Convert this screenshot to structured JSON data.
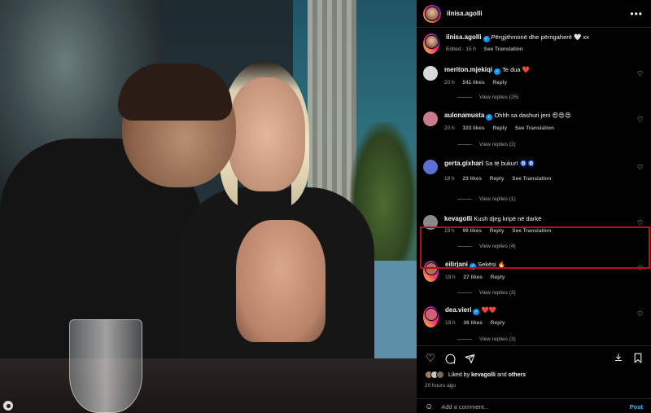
{
  "post": {
    "author": "ilnisa.agolli",
    "caption": "Përgjithmonë dhe përngaherë 🤍 xx",
    "caption_meta": {
      "edited": "Edited · 15 h",
      "see_translation": "See Translation"
    },
    "liked_by_prefix": "Liked by",
    "liked_by_user": "kevagolli",
    "liked_by_and": "and",
    "liked_by_others": "others",
    "time_ago": "20 hours ago",
    "comment_placeholder": "Add a comment...",
    "post_label": "Post"
  },
  "comments": [
    {
      "user": "meriton.mjekiqi",
      "verified": true,
      "text": "Te dua ❤️",
      "time": "20 h",
      "likes": "541 likes",
      "reply": "Reply",
      "translate": "",
      "view_replies": "View replies (25)",
      "avatar_color": "#d9d9d9"
    },
    {
      "user": "aulonamusta",
      "verified": true,
      "text": "Ohhh sa dashuri jeni 😍😍😍",
      "time": "20 h",
      "likes": "103 likes",
      "reply": "Reply",
      "translate": "See Translation",
      "view_replies": "View replies (2)",
      "avatar_color": "#c97b8f"
    },
    {
      "user": "gerta.gixhari",
      "verified": false,
      "text": "Sa të bukur! 🧿🧿",
      "time": "18 h",
      "likes": "23 likes",
      "reply": "Reply",
      "translate": "See Translation",
      "view_replies": "View replies (1)",
      "avatar_color": "#5b6fd4"
    },
    {
      "user": "kevagolli",
      "verified": false,
      "text": "Kush djeg kripë në darkë",
      "time": "19 h",
      "likes": "99 likes",
      "reply": "Reply",
      "translate": "See Translation",
      "view_replies": "View replies (4)",
      "avatar_color": "#8a8a8a"
    },
    {
      "user": "eilirjani",
      "verified": true,
      "text": "Sekësi 🔥",
      "time": "19 h",
      "likes": "27 likes",
      "reply": "Reply",
      "translate": "",
      "view_replies": "View replies (3)",
      "avatar_color": "#b56a5a"
    },
    {
      "user": "dea.vieri",
      "verified": true,
      "text": "❤️❤️",
      "time": "19 h",
      "likes": "36 likes",
      "reply": "Reply",
      "translate": "",
      "view_replies": "View replies (3)",
      "avatar_color": "#d0607a"
    }
  ],
  "colors": {
    "accent": "#0095f6",
    "highlight": "#b3121b",
    "post_button": "#4db5f9"
  },
  "icons": [
    "more-icon",
    "heart-icon",
    "comment-icon",
    "share-icon",
    "save-icon",
    "emoji-icon"
  ]
}
